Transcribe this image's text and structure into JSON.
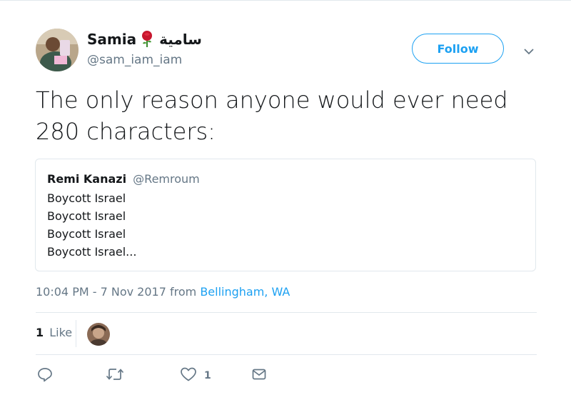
{
  "author": {
    "display_name": "Samia",
    "arabic_name": "سامية",
    "handle": "@sam_iam_iam",
    "emoji_icon": "rose-icon"
  },
  "header": {
    "follow_label": "Follow"
  },
  "tweet": {
    "text": "The only reason anyone would ever need 280 characters:"
  },
  "quoted_tweet": {
    "name": "Remi Kanazi",
    "handle": "@Remroum",
    "lines": [
      "Boycott Israel",
      "Boycott Israel",
      "Boycott Israel",
      "Boycott Israel..."
    ]
  },
  "meta": {
    "timestamp": "10:04 PM - 7 Nov 2017",
    "from_label": "from",
    "location": "Bellingham, WA"
  },
  "stats": {
    "likes_count": "1",
    "likes_label": "Like"
  },
  "actions": {
    "reply_icon": "reply-icon",
    "retweet_icon": "retweet-icon",
    "like_icon": "heart-icon",
    "like_count": "1",
    "dm_icon": "envelope-icon"
  },
  "colors": {
    "accent": "#1da1f2",
    "secondary_text": "#657786",
    "border": "#e1e8ed"
  }
}
